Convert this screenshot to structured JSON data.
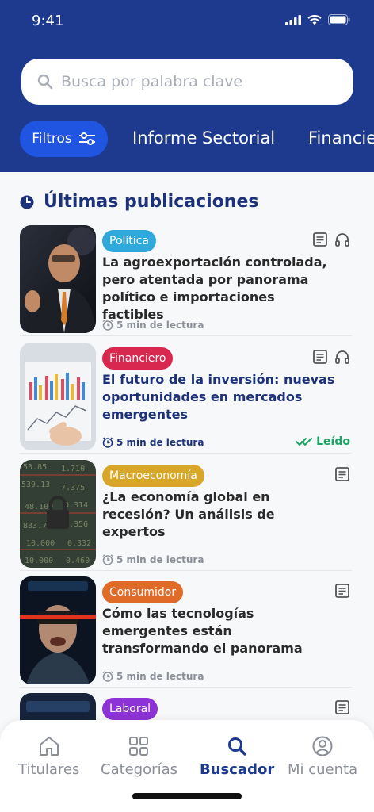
{
  "status_bar": {
    "time": "9:41"
  },
  "search": {
    "placeholder": "Busca por palabra clave"
  },
  "filters": {
    "button_label": "Filtros",
    "tabs": [
      "Informe Sectorial",
      "Financie"
    ]
  },
  "section": {
    "title": "Últimas publicaciones"
  },
  "articles": [
    {
      "tag": "Política",
      "tag_color": "#2fa9dc",
      "title": "La agroexportación controlada, pero atentada por panorama político e importaciones factibles",
      "read_time": "5 min de lectura",
      "icons": [
        "document-icon",
        "headphones-icon"
      ]
    },
    {
      "tag": "Financiero",
      "tag_color": "#d9284f",
      "title": "El futuro de la inversión: nuevas oportunidades en mercados emergentes",
      "read_time": "5 min de lectura",
      "status": "Leído",
      "icons": [
        "document-icon",
        "headphones-icon"
      ]
    },
    {
      "tag": "Macroeconomía",
      "tag_color": "#d8a628",
      "title": "¿La economía global en recesión?  Un análisis de expertos",
      "read_time": "5 min de lectura",
      "locked": true,
      "icons": [
        "document-icon"
      ]
    },
    {
      "tag": "Consumidor",
      "tag_color": "#e06a28",
      "title": "Cómo las tecnologías emergentes están transformando el panorama",
      "read_time": "5 min de lectura",
      "icons": [
        "document-icon"
      ]
    },
    {
      "tag": "Laboral",
      "tag_color": "#8d32d6",
      "icons": [
        "document-icon"
      ]
    }
  ],
  "bottom_nav": [
    {
      "label": "Titulares",
      "icon": "home-icon"
    },
    {
      "label": "Categorías",
      "icon": "grid-icon"
    },
    {
      "label": "Buscador",
      "icon": "search-icon",
      "active": true
    },
    {
      "label": "Mi cuenta",
      "icon": "user-icon"
    }
  ]
}
